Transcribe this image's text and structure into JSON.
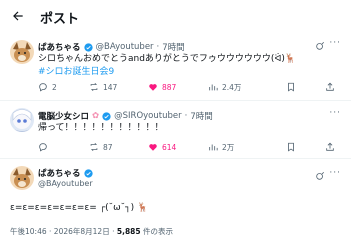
{
  "header": {
    "title": "ポスト"
  },
  "reply1": {
    "name": "ぱあちゃる",
    "handle": "@BAyoutuber",
    "time": "7時間",
    "text": "シロちゃんおめでとうandありがとうでフゥウウウウウウ(ᐛ)",
    "hashtag": "#シロお誕生日会9",
    "actions": {
      "replies": "2",
      "retweets": "147",
      "likes": "887",
      "views": "2.4万"
    }
  },
  "reply2": {
    "name": "電脳少女シロ",
    "handle": "@SIROyoutuber",
    "time": "7時間",
    "text": "帰って！！！！！！！！！！！",
    "actions": {
      "replies": "",
      "retweets": "87",
      "likes": "614",
      "views": "2万"
    }
  },
  "main": {
    "name": "ぱあちゃる",
    "handle": "@BAyoutuber",
    "text": "ε=ε=ε=ε=ε=ε=ε= ┌(˘ω˘┐) ",
    "time": "午後10:46",
    "date": "2026年8月12日",
    "views_count": "5,885",
    "views_label": "件の表示"
  },
  "icons": [
    "back-arrow-icon",
    "verified-badge-icon",
    "grok-icon",
    "more-icon",
    "reply-icon",
    "retweet-icon",
    "like-icon",
    "views-icon",
    "bookmark-icon",
    "share-icon"
  ],
  "colors": {
    "accent": "#1d9bf0",
    "like": "#f91880",
    "muted": "#536471",
    "verified": "#1d9bf0"
  }
}
